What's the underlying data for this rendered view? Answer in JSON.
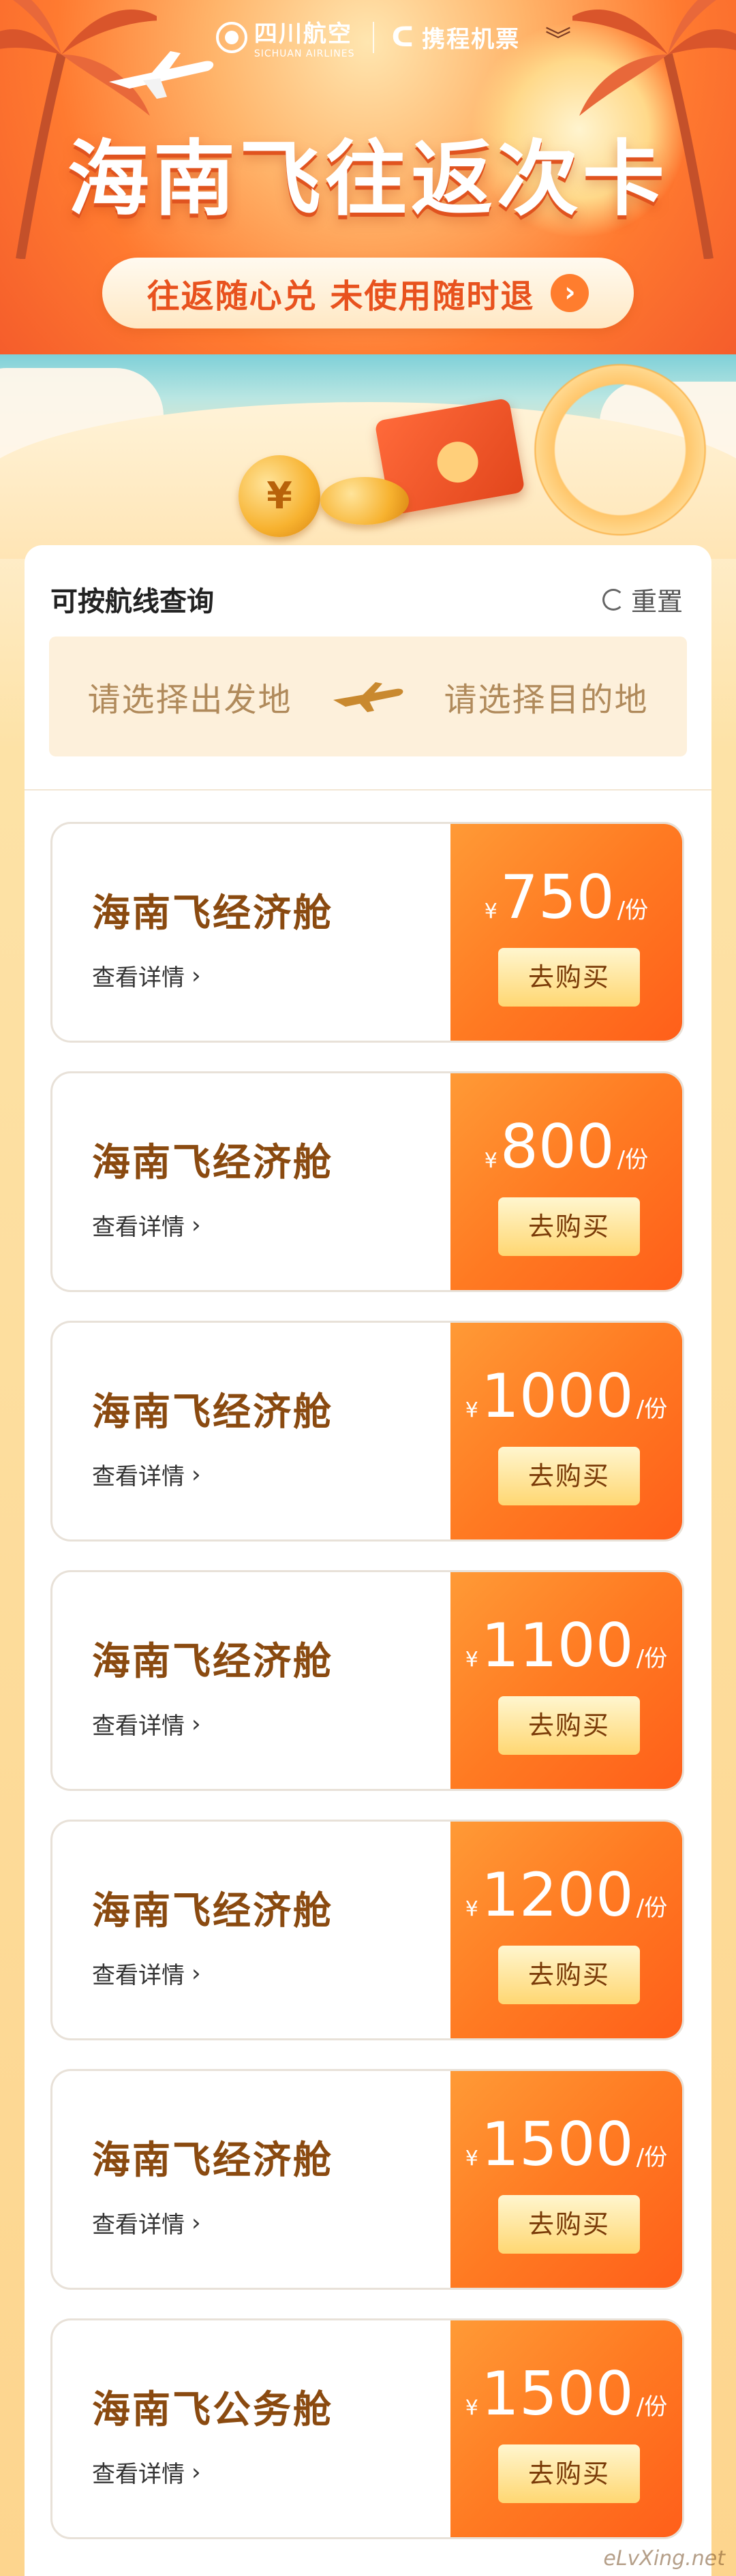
{
  "header": {
    "airline_name": "四川航空",
    "airline_sub": "SICHUAN AIRLINES",
    "partner_name": "携程机票"
  },
  "hero": {
    "title": "海南飞往返次卡",
    "subtitle": "往返随心兑 未使用随时退",
    "arrow": "›"
  },
  "search": {
    "title": "可按航线查询",
    "reset_label": "重置",
    "from_placeholder": "请选择出发地",
    "to_placeholder": "请选择目的地"
  },
  "products": [
    {
      "name": "海南飞经济舱",
      "detail": "查看详情",
      "currency": "¥",
      "price": "750",
      "unit": "/份",
      "buy": "去购买"
    },
    {
      "name": "海南飞经济舱",
      "detail": "查看详情",
      "currency": "¥",
      "price": "800",
      "unit": "/份",
      "buy": "去购买"
    },
    {
      "name": "海南飞经济舱",
      "detail": "查看详情",
      "currency": "¥",
      "price": "1000",
      "unit": "/份",
      "buy": "去购买"
    },
    {
      "name": "海南飞经济舱",
      "detail": "查看详情",
      "currency": "¥",
      "price": "1100",
      "unit": "/份",
      "buy": "去购买"
    },
    {
      "name": "海南飞经济舱",
      "detail": "查看详情",
      "currency": "¥",
      "price": "1200",
      "unit": "/份",
      "buy": "去购买"
    },
    {
      "name": "海南飞经济舱",
      "detail": "查看详情",
      "currency": "¥",
      "price": "1500",
      "unit": "/份",
      "buy": "去购买"
    },
    {
      "name": "海南飞公务舱",
      "detail": "查看详情",
      "currency": "¥",
      "price": "1500",
      "unit": "/份",
      "buy": "去购买"
    }
  ],
  "watermark": "eLvXing.net",
  "colors": {
    "accent": "#ff7a22",
    "title_brown": "#8a4a10",
    "route_bg": "#fdf0db"
  }
}
